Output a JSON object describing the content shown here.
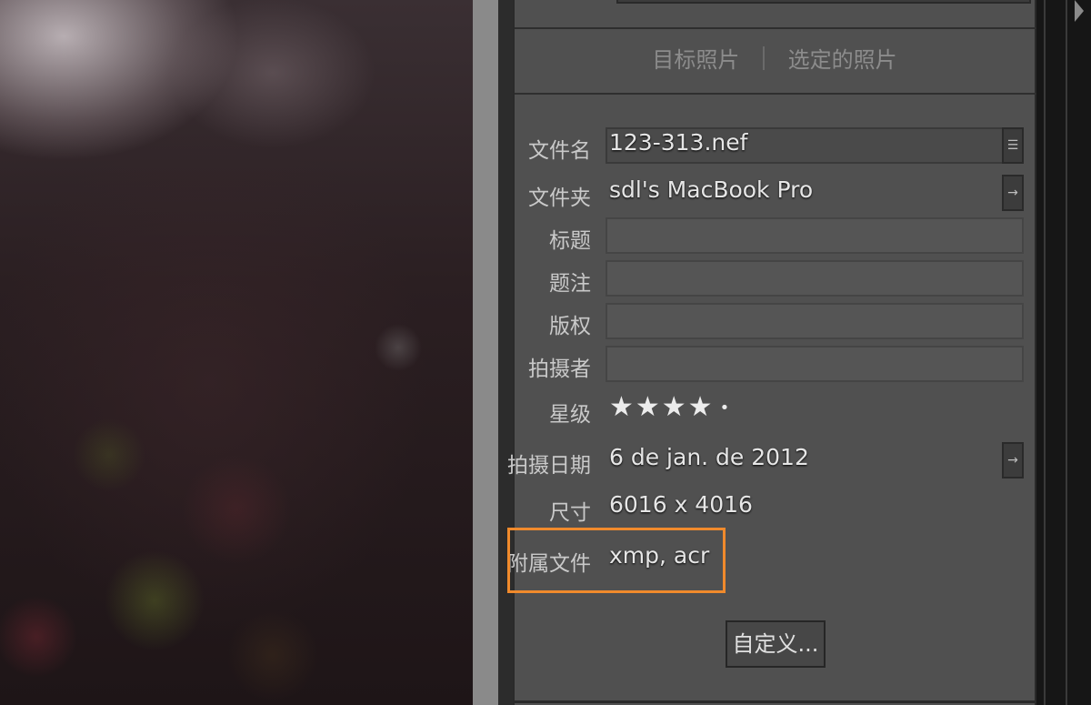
{
  "tabs": {
    "target_photo": "目标照片",
    "selected_photos": "选定的照片"
  },
  "metadata": {
    "filename": {
      "label": "文件名",
      "value": "123-313.nef"
    },
    "folder": {
      "label": "文件夹",
      "value": "sdl's MacBook Pro"
    },
    "title": {
      "label": "标题",
      "value": ""
    },
    "caption": {
      "label": "题注",
      "value": ""
    },
    "copyright": {
      "label": "版权",
      "value": ""
    },
    "creator": {
      "label": "拍摄者",
      "value": ""
    },
    "rating": {
      "label": "星级",
      "stars": 4,
      "max": 5,
      "display": "★★★★"
    },
    "capture_date": {
      "label": "拍摄日期",
      "value": "6 de jan. de 2012"
    },
    "dimensions": {
      "label": "尺寸",
      "value": "6016 x 4016"
    },
    "sidecar_files": {
      "label": "附属文件",
      "value": "xmp, acr"
    }
  },
  "buttons": {
    "customize": "自定义..."
  },
  "colors": {
    "highlight": "#f08a2c",
    "panel_bg": "#505050"
  }
}
